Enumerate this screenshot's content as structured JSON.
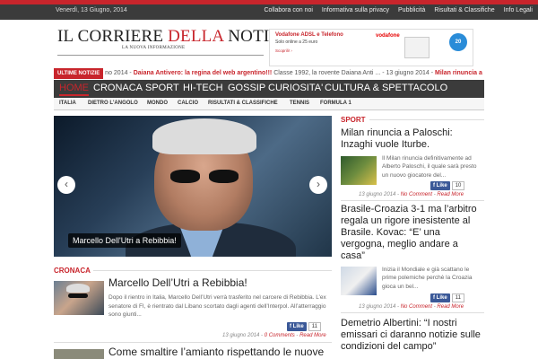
{
  "topbar": {
    "date": "Venerdì, 13 Giugno, 2014",
    "links": [
      "Collabora con noi",
      "Informativa sulla privacy",
      "Pubblicità",
      "Risultati & Classifiche",
      "Info Legali"
    ]
  },
  "logo": {
    "part1": "IL CORRIERE ",
    "part2": "DELLA",
    "part3": " NOTIZIA",
    "tagline": "LA NUOVA INFORMAZIONE"
  },
  "banner": {
    "line1": "Vodafone ADSL e Telefono",
    "line2": "Solo online a 25 euro",
    "line3": "Scoprili! ›",
    "brand": "vodafone",
    "badge": "20 mega"
  },
  "ticker": {
    "label": "ULTIME NOTIZIE",
    "text_pre": "no 2014 - ",
    "headline1": "Daiana Antivero: la regina del web argentino!!!",
    "text_mid": " Classe 1992, la rovente Daiana Anti ... - 13 giugno 2014 - ",
    "headline2": "Milan rinuncia a"
  },
  "nav": {
    "items": [
      "HOME",
      "CRONACA",
      "SPORT",
      "HI-TECH",
      "GOSSIP",
      "CURIOSITA'",
      "CULTURA & SPETTACOLO"
    ]
  },
  "subnav": {
    "items": [
      "ITALIA",
      "DIETRO L'ANGOLO",
      "MONDO",
      "CALCIO",
      "RISULTATI & CLASSIFICHE",
      "TENNIS",
      "FORMULA 1"
    ]
  },
  "slider": {
    "caption": "Marcello Dell'Utri a Rebibbia!",
    "prev": "‹",
    "next": "›"
  },
  "cronaca": {
    "section": "CRONACA",
    "article": {
      "title": "Marcello Dell’Utri a Rebibbia!",
      "text": "Dopo il rientro in Italia, Marcello Dell’Utri verrà trasferito nel carcere di Rebibbia. L’ex senatore di FI, è rientrato dal Libano scortato dagli agenti dell’Interpol. All’atterraggio sono giunti...",
      "date": "13 giugno 2014",
      "comments": "0 Comments",
      "more": "Read More",
      "like": "Like",
      "count": "11"
    },
    "article2": {
      "title": "Come smaltire l’amianto rispettando le nuove"
    }
  },
  "sport": {
    "section": "SPORT",
    "articles": [
      {
        "title": "Milan rinuncia a Paloschi: Inzaghi vuole Iturbe.",
        "text": "Il Milan rinuncia definitivamente ad Alberto Paloschi, il quale sarà presto un nuovo giocatore del...",
        "date": "13 giugno 2014",
        "comments": "No Comment",
        "more": "Read More",
        "like": "Like",
        "count": "10"
      },
      {
        "title": "Brasile-Croazia 3-1 ma l’arbitro regala un rigore inesistente al Brasile. Kovac: “E’ una vergogna, meglio andare a casa”",
        "text": "Inizia il Mondiale e già scattano le prime polemiche perchè la Croazia gioca un bel...",
        "date": "13 giugno 2014",
        "comments": "No Comment",
        "more": "Read More",
        "like": "Like",
        "count": "11"
      },
      {
        "title": "Demetrio Albertini: “I nostri emissari ci daranno notizie sulle condizioni del campo”"
      }
    ]
  },
  "colors": {
    "accent": "#c8252c",
    "nav_bg": "#3b3b3b",
    "facebook": "#3b5998"
  }
}
